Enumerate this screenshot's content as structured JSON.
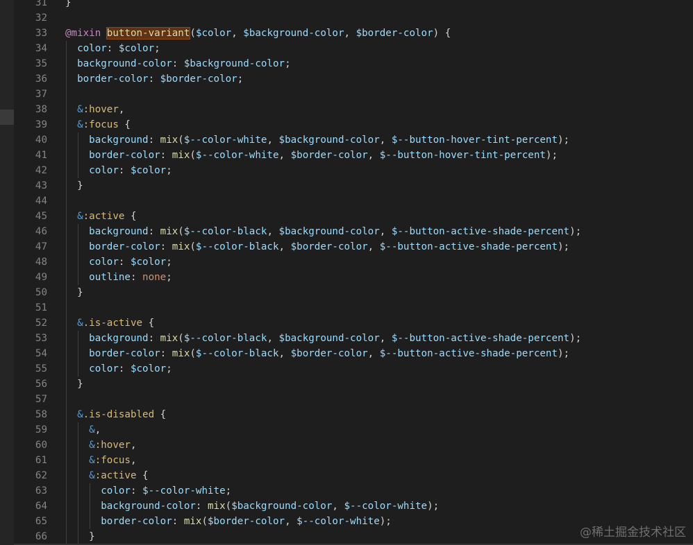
{
  "editor": {
    "language": "scss",
    "watermark": "@稀土掘金技术社区",
    "lines": [
      {
        "n": "31",
        "i": 0,
        "t": [
          [
            "}",
            "punc"
          ]
        ]
      },
      {
        "n": "32",
        "i": 0,
        "t": []
      },
      {
        "n": "33",
        "i": 0,
        "t": [
          [
            "@mixin",
            "kw"
          ],
          [
            " ",
            "punc"
          ],
          [
            "button-variant",
            "hl"
          ],
          [
            "(",
            "punc"
          ],
          [
            "$color",
            "var"
          ],
          [
            ", ",
            "punc"
          ],
          [
            "$background-color",
            "var"
          ],
          [
            ", ",
            "punc"
          ],
          [
            "$border-color",
            "var"
          ],
          [
            ") {",
            "punc"
          ]
        ]
      },
      {
        "n": "34",
        "i": 1,
        "t": [
          [
            "color",
            "prop"
          ],
          [
            ": ",
            "punc"
          ],
          [
            "$color",
            "var"
          ],
          [
            ";",
            "punc"
          ]
        ]
      },
      {
        "n": "35",
        "i": 1,
        "t": [
          [
            "background-color",
            "prop"
          ],
          [
            ": ",
            "punc"
          ],
          [
            "$background-color",
            "var"
          ],
          [
            ";",
            "punc"
          ]
        ]
      },
      {
        "n": "36",
        "i": 1,
        "t": [
          [
            "border-color",
            "prop"
          ],
          [
            ": ",
            "punc"
          ],
          [
            "$border-color",
            "var"
          ],
          [
            ";",
            "punc"
          ]
        ]
      },
      {
        "n": "37",
        "i": 1,
        "t": []
      },
      {
        "n": "38",
        "i": 1,
        "t": [
          [
            "&",
            "key"
          ],
          [
            ":hover",
            "sel"
          ],
          [
            ",",
            "punc"
          ]
        ]
      },
      {
        "n": "39",
        "i": 1,
        "t": [
          [
            "&",
            "key"
          ],
          [
            ":focus",
            "sel"
          ],
          [
            " {",
            "punc"
          ]
        ]
      },
      {
        "n": "40",
        "i": 2,
        "t": [
          [
            "background",
            "prop"
          ],
          [
            ": ",
            "punc"
          ],
          [
            "mix",
            "fn"
          ],
          [
            "(",
            "punc"
          ],
          [
            "$--color-white",
            "var"
          ],
          [
            ", ",
            "punc"
          ],
          [
            "$background-color",
            "var"
          ],
          [
            ", ",
            "punc"
          ],
          [
            "$--button-hover-tint-percent",
            "var"
          ],
          [
            ");",
            "punc"
          ]
        ]
      },
      {
        "n": "41",
        "i": 2,
        "t": [
          [
            "border-color",
            "prop"
          ],
          [
            ": ",
            "punc"
          ],
          [
            "mix",
            "fn"
          ],
          [
            "(",
            "punc"
          ],
          [
            "$--color-white",
            "var"
          ],
          [
            ", ",
            "punc"
          ],
          [
            "$border-color",
            "var"
          ],
          [
            ", ",
            "punc"
          ],
          [
            "$--button-hover-tint-percent",
            "var"
          ],
          [
            ");",
            "punc"
          ]
        ]
      },
      {
        "n": "42",
        "i": 2,
        "t": [
          [
            "color",
            "prop"
          ],
          [
            ": ",
            "punc"
          ],
          [
            "$color",
            "var"
          ],
          [
            ";",
            "punc"
          ]
        ]
      },
      {
        "n": "43",
        "i": 1,
        "t": [
          [
            "}",
            "punc"
          ]
        ]
      },
      {
        "n": "44",
        "i": 1,
        "t": []
      },
      {
        "n": "45",
        "i": 1,
        "t": [
          [
            "&",
            "key"
          ],
          [
            ":active",
            "sel"
          ],
          [
            " {",
            "punc"
          ]
        ]
      },
      {
        "n": "46",
        "i": 2,
        "t": [
          [
            "background",
            "prop"
          ],
          [
            ": ",
            "punc"
          ],
          [
            "mix",
            "fn"
          ],
          [
            "(",
            "punc"
          ],
          [
            "$--color-black",
            "var"
          ],
          [
            ", ",
            "punc"
          ],
          [
            "$background-color",
            "var"
          ],
          [
            ", ",
            "punc"
          ],
          [
            "$--button-active-shade-percent",
            "var"
          ],
          [
            ");",
            "punc"
          ]
        ]
      },
      {
        "n": "47",
        "i": 2,
        "t": [
          [
            "border-color",
            "prop"
          ],
          [
            ": ",
            "punc"
          ],
          [
            "mix",
            "fn"
          ],
          [
            "(",
            "punc"
          ],
          [
            "$--color-black",
            "var"
          ],
          [
            ", ",
            "punc"
          ],
          [
            "$border-color",
            "var"
          ],
          [
            ", ",
            "punc"
          ],
          [
            "$--button-active-shade-percent",
            "var"
          ],
          [
            ");",
            "punc"
          ]
        ]
      },
      {
        "n": "48",
        "i": 2,
        "t": [
          [
            "color",
            "prop"
          ],
          [
            ": ",
            "punc"
          ],
          [
            "$color",
            "var"
          ],
          [
            ";",
            "punc"
          ]
        ]
      },
      {
        "n": "49",
        "i": 2,
        "t": [
          [
            "outline",
            "prop"
          ],
          [
            ": ",
            "punc"
          ],
          [
            "none",
            "str"
          ],
          [
            ";",
            "punc"
          ]
        ]
      },
      {
        "n": "50",
        "i": 1,
        "t": [
          [
            "}",
            "punc"
          ]
        ]
      },
      {
        "n": "51",
        "i": 1,
        "t": []
      },
      {
        "n": "52",
        "i": 1,
        "t": [
          [
            "&",
            "key"
          ],
          [
            ".is-active",
            "sel"
          ],
          [
            " {",
            "punc"
          ]
        ]
      },
      {
        "n": "53",
        "i": 2,
        "t": [
          [
            "background",
            "prop"
          ],
          [
            ": ",
            "punc"
          ],
          [
            "mix",
            "fn"
          ],
          [
            "(",
            "punc"
          ],
          [
            "$--color-black",
            "var"
          ],
          [
            ", ",
            "punc"
          ],
          [
            "$background-color",
            "var"
          ],
          [
            ", ",
            "punc"
          ],
          [
            "$--button-active-shade-percent",
            "var"
          ],
          [
            ");",
            "punc"
          ]
        ]
      },
      {
        "n": "54",
        "i": 2,
        "t": [
          [
            "border-color",
            "prop"
          ],
          [
            ": ",
            "punc"
          ],
          [
            "mix",
            "fn"
          ],
          [
            "(",
            "punc"
          ],
          [
            "$--color-black",
            "var"
          ],
          [
            ", ",
            "punc"
          ],
          [
            "$border-color",
            "var"
          ],
          [
            ", ",
            "punc"
          ],
          [
            "$--button-active-shade-percent",
            "var"
          ],
          [
            ");",
            "punc"
          ]
        ]
      },
      {
        "n": "55",
        "i": 2,
        "t": [
          [
            "color",
            "prop"
          ],
          [
            ": ",
            "punc"
          ],
          [
            "$color",
            "var"
          ],
          [
            ";",
            "punc"
          ]
        ]
      },
      {
        "n": "56",
        "i": 1,
        "t": [
          [
            "}",
            "punc"
          ]
        ]
      },
      {
        "n": "57",
        "i": 1,
        "t": []
      },
      {
        "n": "58",
        "i": 1,
        "t": [
          [
            "&",
            "key"
          ],
          [
            ".is-disabled",
            "sel"
          ],
          [
            " {",
            "punc"
          ]
        ]
      },
      {
        "n": "59",
        "i": 2,
        "t": [
          [
            "&",
            "key"
          ],
          [
            ",",
            "punc"
          ]
        ]
      },
      {
        "n": "60",
        "i": 2,
        "t": [
          [
            "&",
            "key"
          ],
          [
            ":hover",
            "sel"
          ],
          [
            ",",
            "punc"
          ]
        ]
      },
      {
        "n": "61",
        "i": 2,
        "t": [
          [
            "&",
            "key"
          ],
          [
            ":focus",
            "sel"
          ],
          [
            ",",
            "punc"
          ]
        ]
      },
      {
        "n": "62",
        "i": 2,
        "t": [
          [
            "&",
            "key"
          ],
          [
            ":active",
            "sel"
          ],
          [
            " {",
            "punc"
          ]
        ]
      },
      {
        "n": "63",
        "i": 3,
        "t": [
          [
            "color",
            "prop"
          ],
          [
            ": ",
            "punc"
          ],
          [
            "$--color-white",
            "var"
          ],
          [
            ";",
            "punc"
          ]
        ]
      },
      {
        "n": "64",
        "i": 3,
        "t": [
          [
            "background-color",
            "prop"
          ],
          [
            ": ",
            "punc"
          ],
          [
            "mix",
            "fn"
          ],
          [
            "(",
            "punc"
          ],
          [
            "$background-color",
            "var"
          ],
          [
            ", ",
            "punc"
          ],
          [
            "$--color-white",
            "var"
          ],
          [
            ");",
            "punc"
          ]
        ]
      },
      {
        "n": "65",
        "i": 3,
        "t": [
          [
            "border-color",
            "prop"
          ],
          [
            ": ",
            "punc"
          ],
          [
            "mix",
            "fn"
          ],
          [
            "(",
            "punc"
          ],
          [
            "$border-color",
            "var"
          ],
          [
            ", ",
            "punc"
          ],
          [
            "$--color-white",
            "var"
          ],
          [
            ");",
            "punc"
          ]
        ]
      },
      {
        "n": "66",
        "i": 2,
        "t": [
          [
            "}",
            "punc"
          ]
        ]
      }
    ]
  }
}
